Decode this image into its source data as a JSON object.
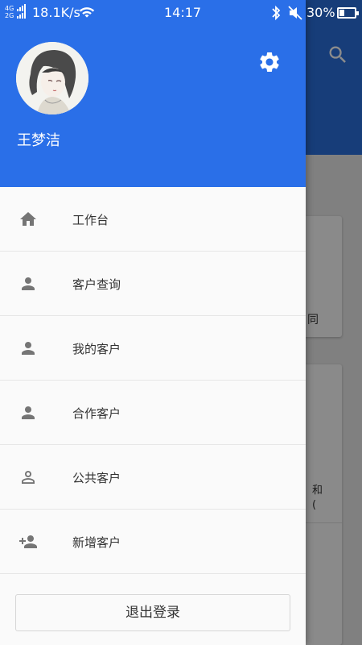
{
  "status_bar": {
    "network_top": "4G",
    "network_bottom": "2G",
    "speed": "18.1K/s",
    "time": "14:17",
    "battery": "30%"
  },
  "background": {
    "card_text": "同",
    "card_text2_line1": "和",
    "card_text2_line2": "("
  },
  "drawer": {
    "username": "王梦洁",
    "header_color": "#2a6fe8",
    "menu": [
      {
        "label": "工作台",
        "icon": "home-icon"
      },
      {
        "label": "客户查询",
        "icon": "person-icon"
      },
      {
        "label": "我的客户",
        "icon": "person-icon"
      },
      {
        "label": "合作客户",
        "icon": "person-icon"
      },
      {
        "label": "公共客户",
        "icon": "person-outline-icon"
      },
      {
        "label": "新增客户",
        "icon": "person-add-icon"
      }
    ],
    "logout_label": "退出登录"
  }
}
